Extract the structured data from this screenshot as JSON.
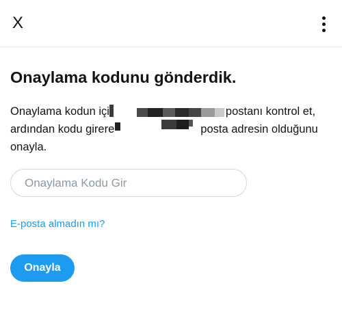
{
  "header": {
    "close_label": "X",
    "close_icon": "close-icon",
    "more_icon": "more-vertical-icon"
  },
  "main": {
    "title": "Onaylama kodunu gönderdik.",
    "description_lines": [
      "Onaylama kodun içi",
      "postanı kontrol et,",
      "ardından kodu girere",
      "posta adresin olduğunu",
      "onayla."
    ],
    "input_placeholder": "Onaylama Kodu Gir",
    "input_value": "",
    "resend_link": "E-posta almadın mı?",
    "confirm_button": "Onayla"
  },
  "colors": {
    "accent": "#1d9bf0",
    "text": "#0f1419",
    "placeholder": "#8b98a5",
    "border": "#cfd9de"
  }
}
